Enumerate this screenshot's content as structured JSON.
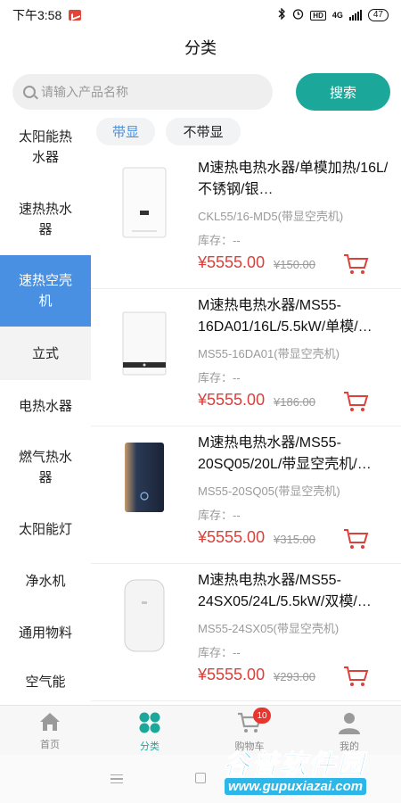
{
  "status_bar": {
    "time": "下午3:58",
    "network": "4G",
    "hd": "HD",
    "battery": "47"
  },
  "header": {
    "title": "分类"
  },
  "search": {
    "placeholder": "请输入产品名称",
    "button_label": "搜索"
  },
  "sidebar": {
    "items": [
      {
        "label": "太阳能热水器"
      },
      {
        "label": "速热热水器"
      },
      {
        "label": "速热空壳机"
      },
      {
        "label": "立式"
      },
      {
        "label": "电热水器"
      },
      {
        "label": "燃气热水器"
      },
      {
        "label": "太阳能灯"
      },
      {
        "label": "净水机"
      },
      {
        "label": "通用物料"
      },
      {
        "label": "空气能"
      }
    ]
  },
  "filters": [
    {
      "label": "带显",
      "active": true
    },
    {
      "label": "不带显",
      "active": false
    }
  ],
  "products": [
    {
      "name": "M速热电热水器/单模加热/16L/不锈钢/银…",
      "model": "CKL55/16-MD5(带显空壳机)",
      "stock": "库存：--",
      "price": "¥5555.00",
      "old_price": "¥150.00"
    },
    {
      "name": "M速热电热水器/MS55-16DA01/16L/5.5kW/单模/…",
      "model": "MS55-16DA01(带显空壳机)",
      "stock": "库存：--",
      "price": "¥5555.00",
      "old_price": "¥186.00"
    },
    {
      "name": "M速热电热水器/MS55-20SQ05/20L/带显空壳机/…",
      "model": "MS55-20SQ05(带显空壳机)",
      "stock": "库存：--",
      "price": "¥5555.00",
      "old_price": "¥315.00"
    },
    {
      "name": "M速热电热水器/MS55-24SX05/24L/5.5kW/双模/…",
      "model": "MS55-24SX05(带显空壳机)",
      "stock": "库存：--",
      "price": "¥5555.00",
      "old_price": "¥293.00"
    }
  ],
  "tabbar": {
    "tabs": [
      {
        "label": "首页"
      },
      {
        "label": "分类"
      },
      {
        "label": "购物车"
      },
      {
        "label": "我的"
      }
    ],
    "cart_badge": "10"
  },
  "watermark": {
    "title": "谷普软件园",
    "url": "www.gupuxiazai.com"
  },
  "colors": {
    "accent": "#1ba89a",
    "sidebar_active": "#4a90e2",
    "price": "#d9413b",
    "badge": "#e8352e"
  }
}
